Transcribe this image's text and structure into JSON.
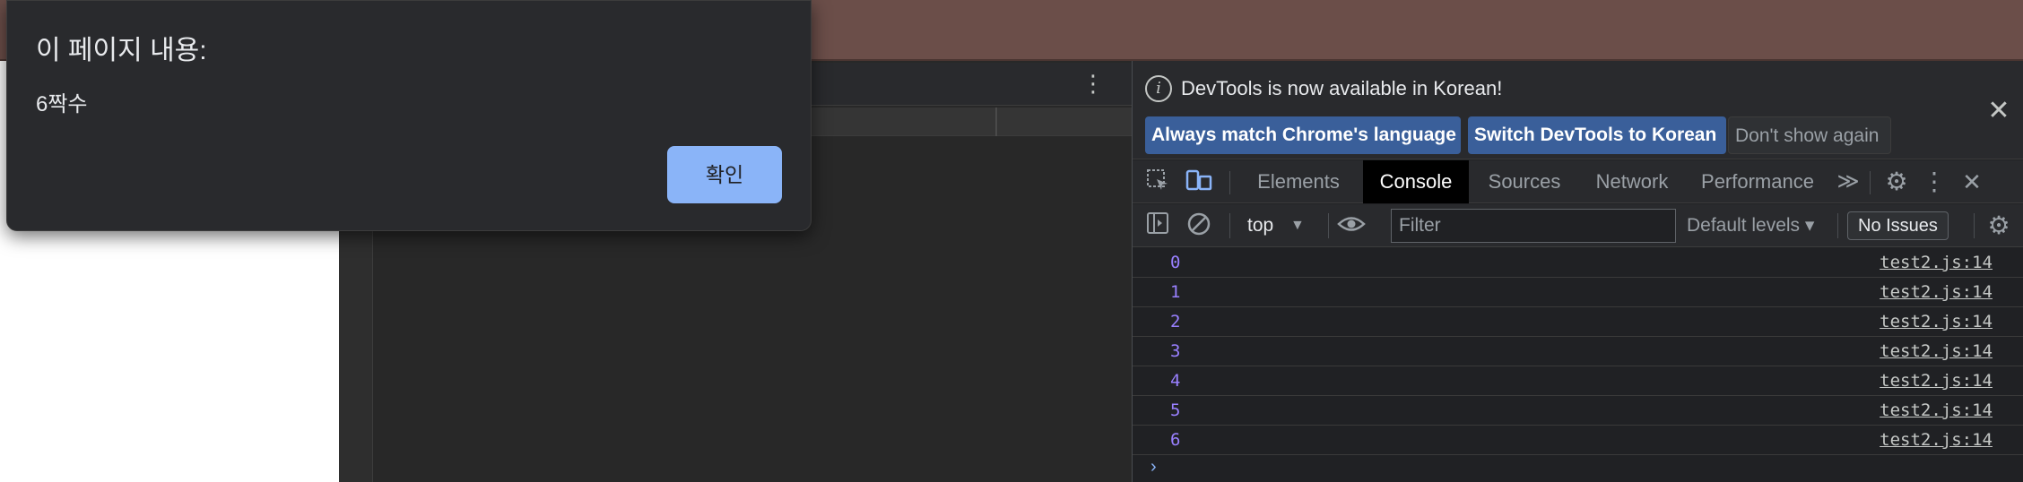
{
  "dialog": {
    "title": "이 페이지 내용:",
    "message": "6짝수",
    "ok_label": "확인"
  },
  "infobar": {
    "message": "DevTools is now available in Korean!",
    "btn_match": "Always match Chrome's language",
    "btn_switch": "Switch DevTools to Korean",
    "btn_dismiss": "Don't show again",
    "info_icon": "i",
    "close_icon": "✕"
  },
  "tabs": {
    "elements": "Elements",
    "console": "Console",
    "sources": "Sources",
    "network": "Network",
    "performance": "Performance",
    "more": "≫",
    "kebab": "⋮",
    "close": "✕",
    "gear": "⚙"
  },
  "console_toolbar": {
    "context": "top",
    "context_arrow": "▼",
    "filter_placeholder": "Filter",
    "levels": "Default levels ▾",
    "issues": "No Issues",
    "gear": "⚙"
  },
  "messages": [
    {
      "value": "0",
      "source": "test2.js:14"
    },
    {
      "value": "1",
      "source": "test2.js:14"
    },
    {
      "value": "2",
      "source": "test2.js:14"
    },
    {
      "value": "3",
      "source": "test2.js:14"
    },
    {
      "value": "4",
      "source": "test2.js:14"
    },
    {
      "value": "5",
      "source": "test2.js:14"
    },
    {
      "value": "6",
      "source": "test2.js:14"
    }
  ],
  "prompt_caret": "›",
  "mid_kebab": "⋮",
  "colors": {
    "accent": "#8ab4f8",
    "console_number": "#9980ff",
    "browser_frame": "#6b4e49",
    "panel_bg": "#202124"
  }
}
